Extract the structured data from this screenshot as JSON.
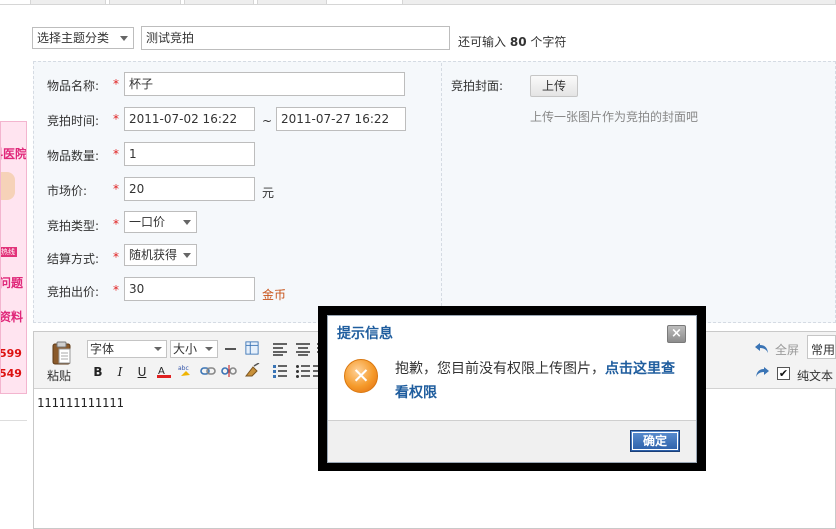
{
  "topic": {
    "category_select": "选择主题分类",
    "title_value": "测试竞拍",
    "char_hint_prefix": "还可输入",
    "char_hint_count": "80",
    "char_hint_suffix": "个字符"
  },
  "ad": {
    "lines": [
      "妇科医院",
      "问题",
      "资料"
    ],
    "numbers": [
      "599",
      "549"
    ],
    "tag": "热线"
  },
  "form": {
    "item_name_label": "物品名称:",
    "item_name_value": "杯子",
    "time_label": "竞拍时间:",
    "time_start": "2011-07-02 16:22",
    "time_sep": "~",
    "time_end": "2011-07-27 16:22",
    "qty_label": "物品数量:",
    "qty_value": "1",
    "market_label": "市场价:",
    "market_value": "20",
    "market_unit": "元",
    "type_label": "竞拍类型:",
    "type_value": "一口价",
    "settle_label": "结算方式:",
    "settle_value": "随机获得",
    "bid_label": "竞拍出价:",
    "bid_value": "30",
    "bid_unit": "金币",
    "required_mark": "*"
  },
  "cover": {
    "label": "竞拍封面:",
    "upload_button": "上传",
    "hint": "上传一张图片作为竞拍的封面吧"
  },
  "editor": {
    "paste_label": "粘贴",
    "font_select": "字体",
    "size_select": "大小",
    "fullscreen": "全屏",
    "common": "常用",
    "plain_text": "纯文本",
    "content": "111111111111"
  },
  "dialog": {
    "title": "提示信息",
    "close": "×",
    "message": "抱歉，您目前没有权限上传图片，",
    "link": "点击这里查看权限",
    "ok_button": "确定"
  },
  "colors": {
    "accent": "#1f5d9e",
    "required": "#e02020",
    "gold": "#c8531a"
  }
}
